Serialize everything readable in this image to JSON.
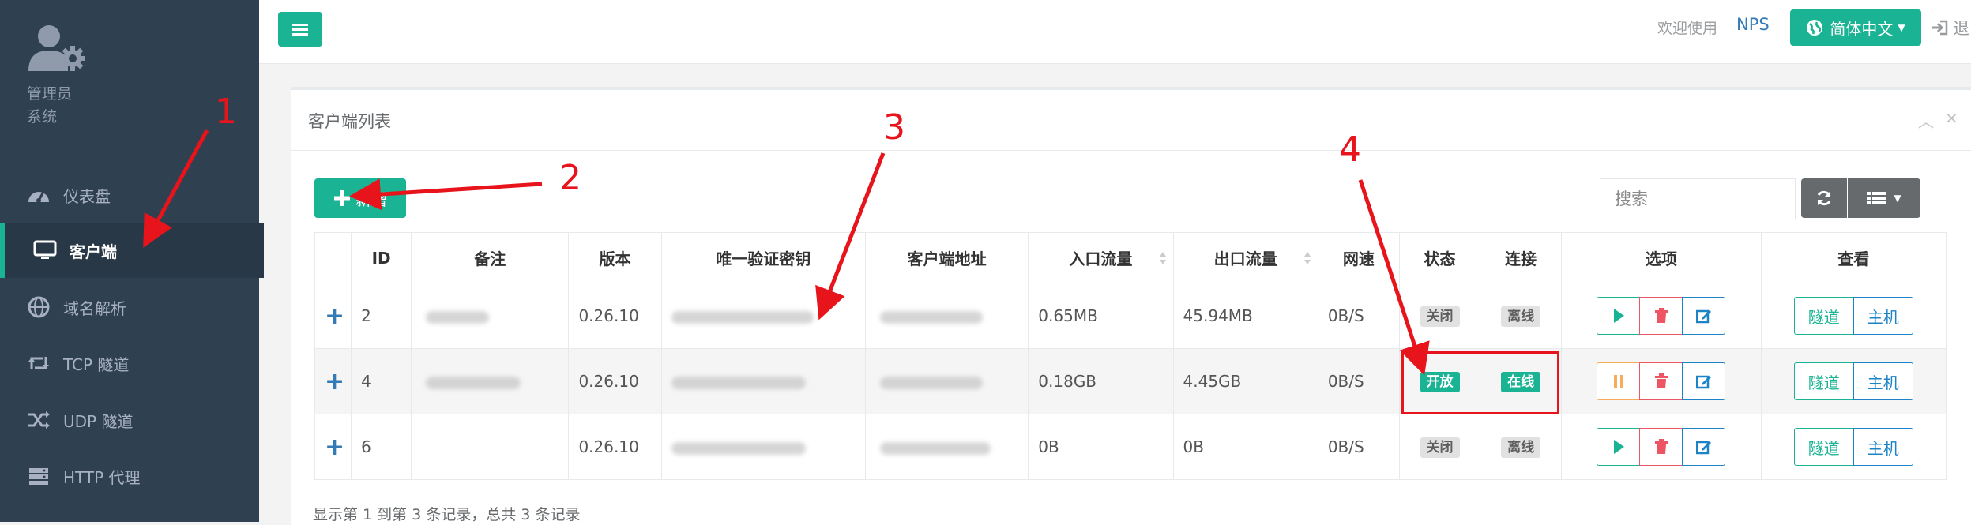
{
  "sidebar": {
    "profile": {
      "name": "管理员",
      "role": "系统"
    },
    "items": [
      {
        "label": "仪表盘",
        "icon": "dashboard-icon",
        "active": false
      },
      {
        "label": "客户端",
        "icon": "desktop-icon",
        "active": true
      },
      {
        "label": "域名解析",
        "icon": "globe-icon",
        "active": false
      },
      {
        "label": "TCP 隧道",
        "icon": "retweet-icon",
        "active": false
      },
      {
        "label": "UDP 隧道",
        "icon": "random-icon",
        "active": false
      },
      {
        "label": "HTTP 代理",
        "icon": "server-icon",
        "active": false
      }
    ]
  },
  "topbar": {
    "welcome": "欢迎使用",
    "brand": "NPS",
    "language": "简体中文",
    "logout": "退"
  },
  "panel": {
    "title": "客户端列表",
    "add_label": "新增",
    "search_placeholder": "搜索",
    "columns": [
      "ID",
      "备注",
      "版本",
      "唯一验证密钥",
      "客户端地址",
      "入口流量",
      "出口流量",
      "网速",
      "状态",
      "连接",
      "选项",
      "查看"
    ],
    "rows": [
      {
        "id": "2",
        "remark": "",
        "version": "0.26.10",
        "vkey": "",
        "addr": "",
        "in_flow": "0.65MB",
        "out_flow": "45.94MB",
        "speed": "0B/S",
        "status": "关闭",
        "connect": "离线",
        "running": false
      },
      {
        "id": "4",
        "remark": "",
        "version": "0.26.10",
        "vkey": "",
        "addr": "",
        "in_flow": "0.18GB",
        "out_flow": "4.45GB",
        "speed": "0B/S",
        "status": "开放",
        "connect": "在线",
        "running": true
      },
      {
        "id": "6",
        "remark": "",
        "version": "0.26.10",
        "vkey": "",
        "addr": "",
        "in_flow": "0B",
        "out_flow": "0B",
        "speed": "0B/S",
        "status": "关闭",
        "connect": "离线",
        "running": false
      }
    ],
    "view_buttons": {
      "tunnel": "隧道",
      "host": "主机"
    },
    "footer": "显示第 1 到第 3 条记录，总共 3 条记录"
  },
  "annotations": [
    "1",
    "2",
    "3",
    "4"
  ],
  "colors": {
    "accent": "#1ab394",
    "sidebar": "#2f4050",
    "annotation": "#e8141c",
    "danger": "#ed5565",
    "warning": "#f8ac59",
    "primary": "#1c84c6"
  }
}
